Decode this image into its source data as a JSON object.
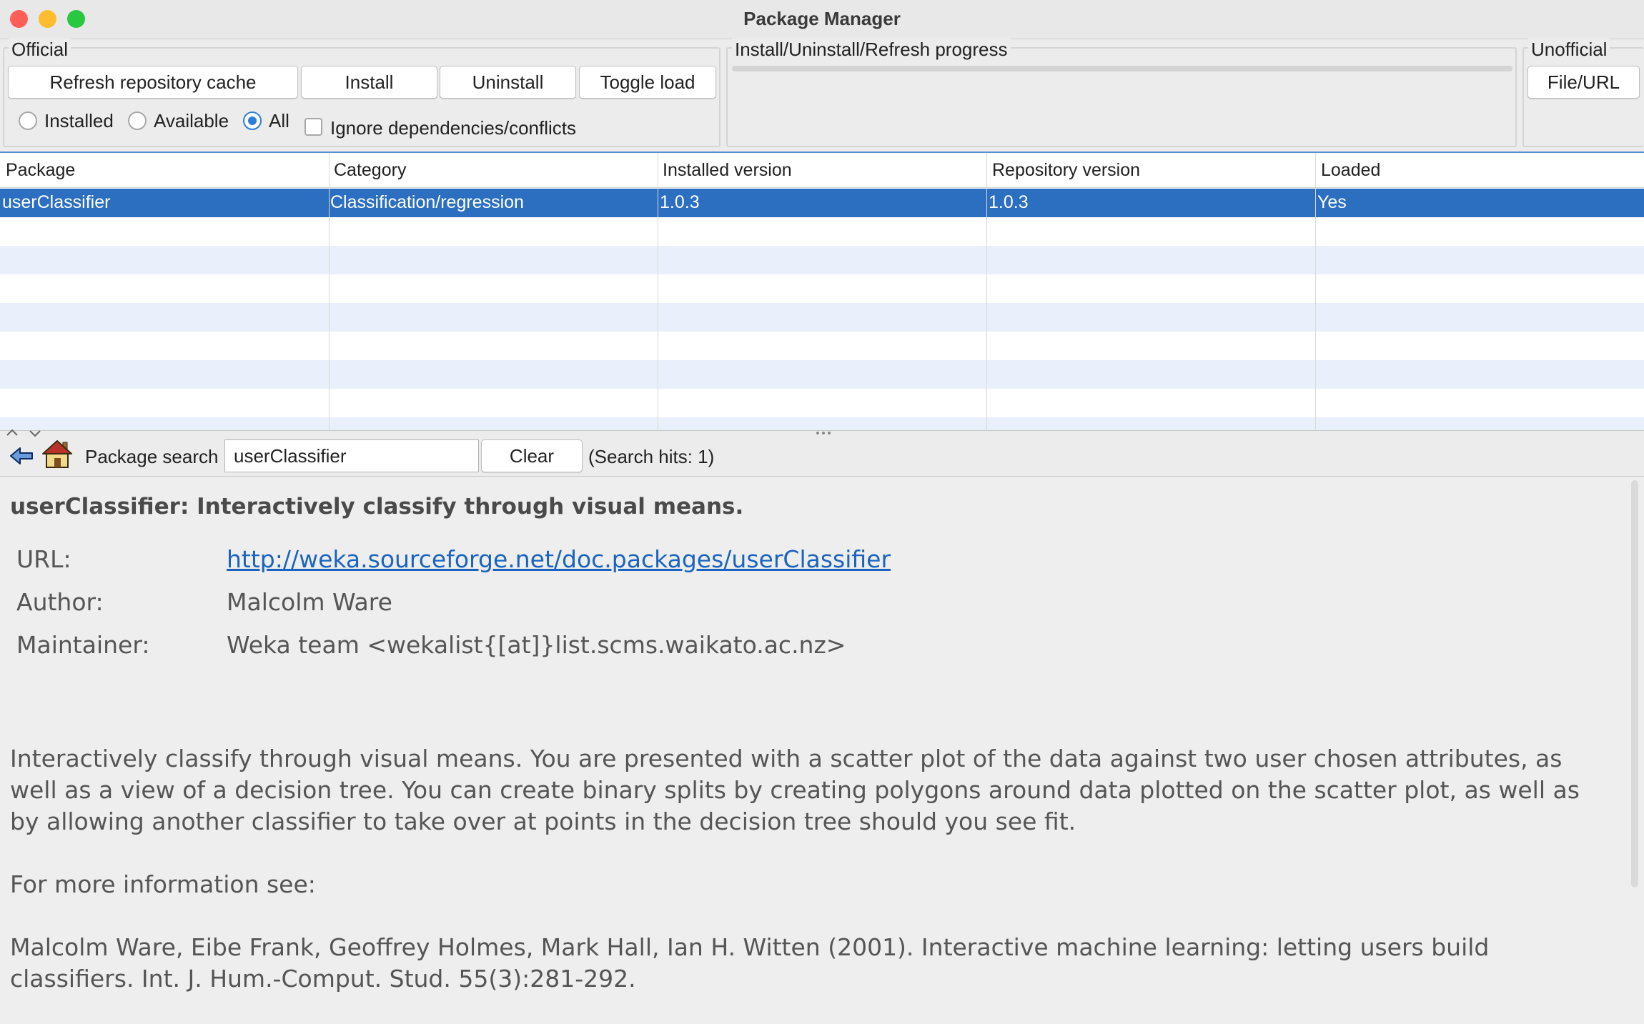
{
  "window": {
    "title": "Package Manager",
    "traffic_lights": {
      "close": "#ff5f57",
      "minimize": "#febc2e",
      "zoom": "#28c840"
    }
  },
  "official": {
    "label": "Official",
    "buttons": {
      "refresh": "Refresh repository cache",
      "install": "Install",
      "uninstall": "Uninstall",
      "toggle_load": "Toggle load"
    },
    "filters": [
      {
        "label": "Installed",
        "selected": false
      },
      {
        "label": "Available",
        "selected": false
      },
      {
        "label": "All",
        "selected": true
      }
    ],
    "ignore_deps": {
      "label": "Ignore dependencies/conflicts",
      "checked": false
    }
  },
  "progress": {
    "label": "Install/Uninstall/Refresh progress",
    "value": 0
  },
  "unofficial": {
    "label": "Unofficial",
    "button": "File/URL"
  },
  "table": {
    "columns": [
      "Package",
      "Category",
      "Installed version",
      "Repository version",
      "Loaded"
    ],
    "rows": [
      [
        "userClassifier",
        "Classification/regression",
        "1.0.3",
        "1.0.3",
        "Yes"
      ]
    ],
    "selected_row": 0
  },
  "search": {
    "label": "Package search",
    "value": "userClassifier",
    "clear_label": "Clear",
    "hits": "(Search hits: 1)"
  },
  "info": {
    "heading": "userClassifier: Interactively classify through visual means.",
    "url_label": "URL:",
    "url": "http://weka.sourceforge.net/doc.packages/userClassifier",
    "author_label": "Author:",
    "author": "Malcolm Ware",
    "maintainer_label": "Maintainer:",
    "maintainer": "Weka team <wekalist{[at]}list.scms.waikato.ac.nz>",
    "description": "Interactively classify through visual means. You are presented with a scatter plot of the data against two user chosen attributes, as well as a view of a decision tree. You can create binary splits by creating polygons around data plotted on the scatter plot, as well as by allowing another classifier to take over at points in the decision tree should you see fit.",
    "more_info": "For more information see:",
    "citation": "Malcolm Ware, Eibe Frank, Geoffrey Holmes, Mark Hall, Ian H. Witten (2001). Interactive machine learning: letting users build classifiers. Int. J. Hum.-Comput. Stud. 55(3):281-292."
  }
}
